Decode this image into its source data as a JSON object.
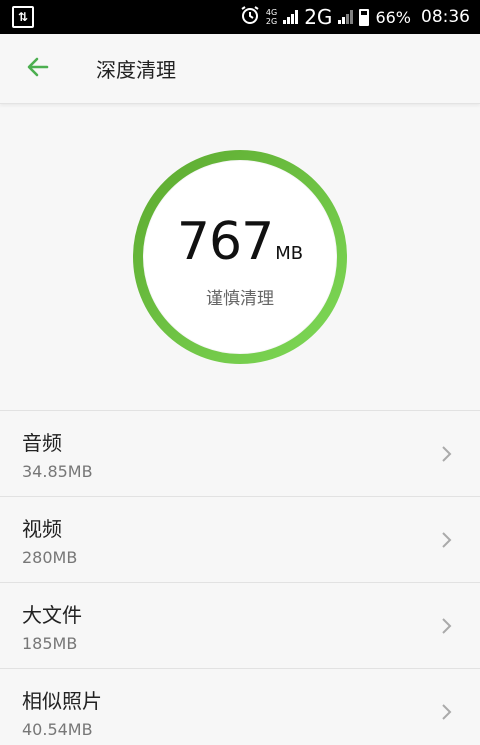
{
  "status_bar": {
    "network_top": "4G",
    "network_bottom": "2G",
    "network_main": "2G",
    "battery": "66%",
    "time": "08:36"
  },
  "toolbar": {
    "title": "深度清理"
  },
  "summary": {
    "size_value": "767",
    "size_unit": "MB",
    "label": "谨慎清理",
    "ring_color_start": "#5daa2f",
    "ring_color_end": "#7ed957"
  },
  "items": [
    {
      "title": "音频",
      "size": "34.85MB"
    },
    {
      "title": "视频",
      "size": "280MB"
    },
    {
      "title": "大文件",
      "size": "185MB"
    },
    {
      "title": "相似照片",
      "size": "40.54MB"
    }
  ],
  "accent_color": "#4caf50"
}
